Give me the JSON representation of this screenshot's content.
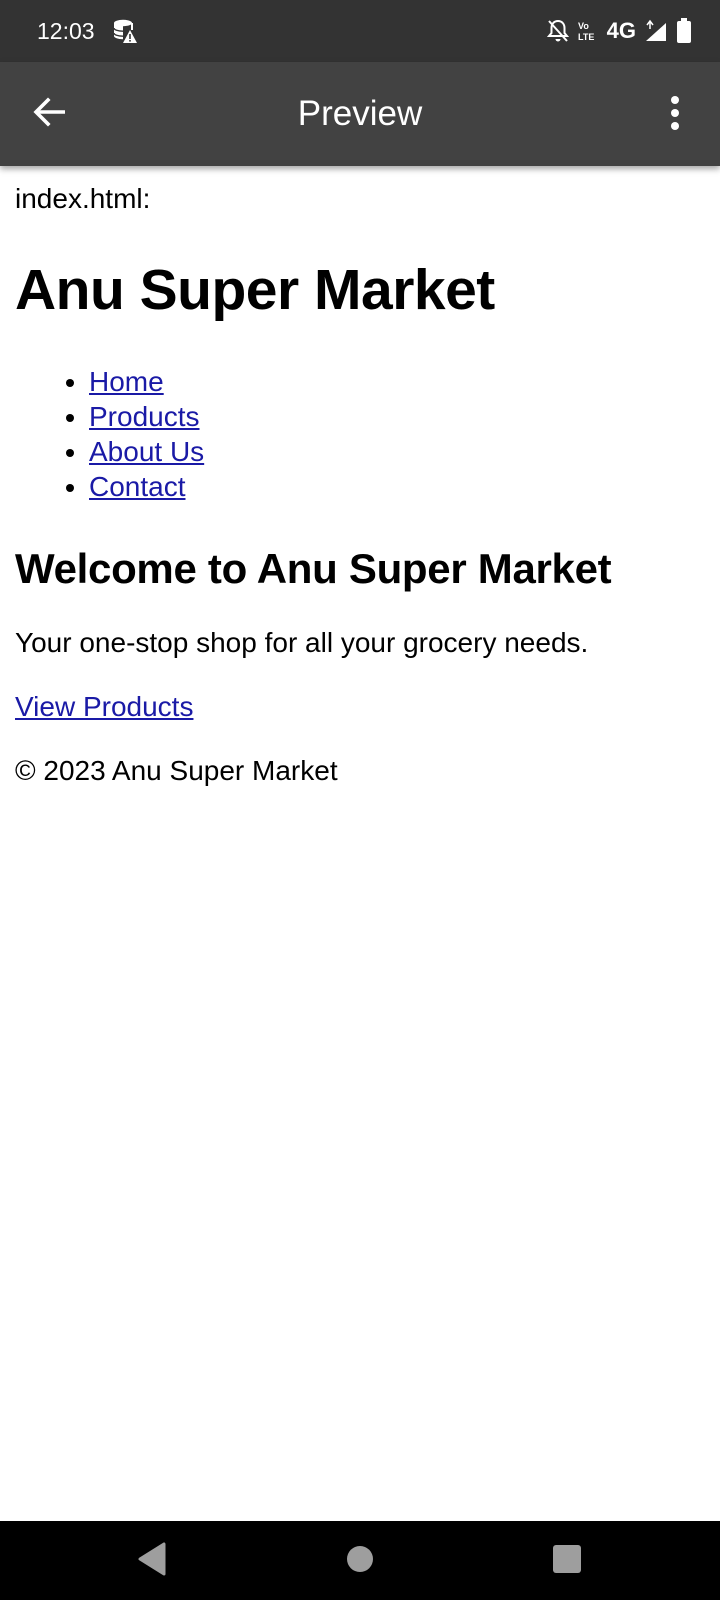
{
  "status_bar": {
    "time": "12:03",
    "network_label": "4G",
    "icons": [
      "database-warning-icon",
      "notifications-off-icon",
      "volte-icon",
      "signal-icon",
      "battery-icon"
    ]
  },
  "app_bar": {
    "title": "Preview",
    "back_icon": "arrow-back-icon",
    "menu_icon": "more-vert-icon"
  },
  "content": {
    "file_label": "index.html:",
    "site_title": "Anu Super Market",
    "nav_links": [
      {
        "label": "Home"
      },
      {
        "label": "Products"
      },
      {
        "label": "About Us"
      },
      {
        "label": "Contact"
      }
    ],
    "welcome_heading": "Welcome to Anu Super Market",
    "tagline": "Your one-stop shop for all your grocery needs.",
    "view_products_link": "View Products",
    "footer": "© 2023 Anu Super Market"
  },
  "nav_bar": {
    "icons": [
      "back-triangle-icon",
      "home-circle-icon",
      "recents-square-icon"
    ]
  },
  "colors": {
    "status_bar_bg": "#333333",
    "app_bar_bg": "#424242",
    "link": "#1a1aa6",
    "nav_bar_bg": "#000000"
  }
}
